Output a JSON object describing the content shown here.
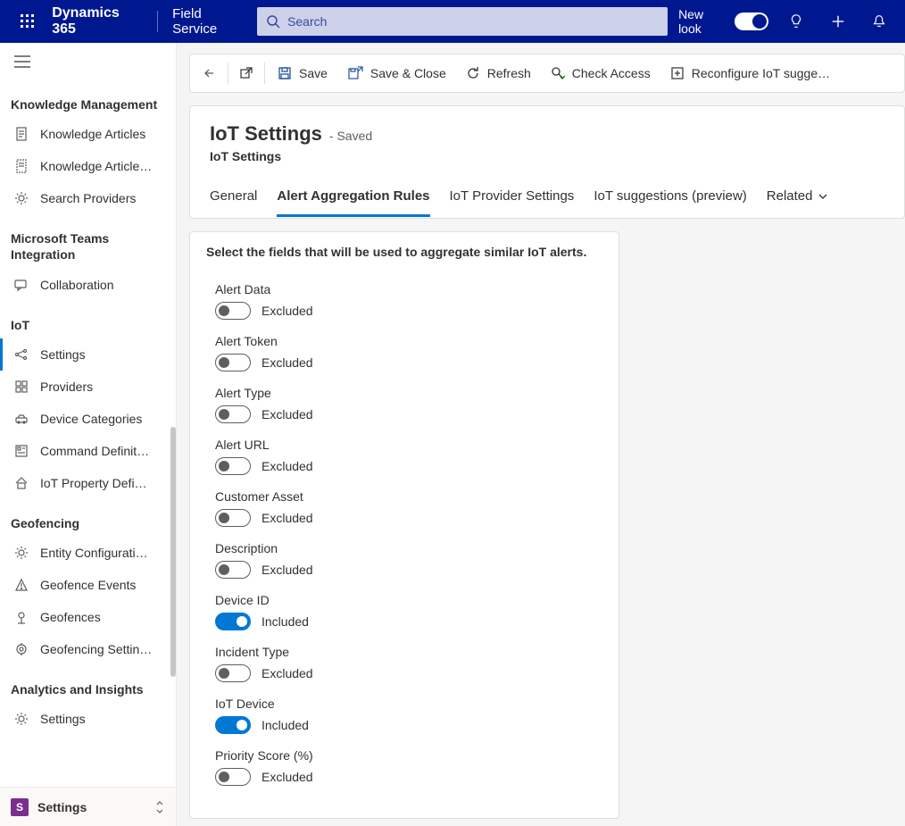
{
  "topbar": {
    "brand": "Dynamics 365",
    "appname": "Field Service",
    "search_placeholder": "Search",
    "newlook_label": "New look"
  },
  "sidebar": {
    "sections": [
      {
        "title": "Knowledge Management",
        "items": [
          {
            "icon": "doc",
            "label": "Knowledge Articles",
            "active": false
          },
          {
            "icon": "doc-dash",
            "label": "Knowledge Article…",
            "active": false
          },
          {
            "icon": "gear",
            "label": "Search Providers",
            "active": false
          }
        ]
      },
      {
        "title": "Microsoft Teams Integration",
        "items": [
          {
            "icon": "chat",
            "label": "Collaboration",
            "active": false
          }
        ]
      },
      {
        "title": "IoT",
        "items": [
          {
            "icon": "nodes",
            "label": "Settings",
            "active": true
          },
          {
            "icon": "grid",
            "label": "Providers",
            "active": false
          },
          {
            "icon": "car",
            "label": "Device Categories",
            "active": false
          },
          {
            "icon": "cmd",
            "label": "Command Definit…",
            "active": false
          },
          {
            "icon": "house",
            "label": "IoT Property Defi…",
            "active": false
          }
        ]
      },
      {
        "title": "Geofencing",
        "items": [
          {
            "icon": "gear",
            "label": "Entity Configurati…",
            "active": false
          },
          {
            "icon": "warn",
            "label": "Geofence Events",
            "active": false
          },
          {
            "icon": "pin",
            "label": "Geofences",
            "active": false
          },
          {
            "icon": "target",
            "label": "Geofencing Settin…",
            "active": false
          }
        ]
      },
      {
        "title": "Analytics and Insights",
        "items": [
          {
            "icon": "gear",
            "label": "Settings",
            "active": false
          }
        ]
      }
    ],
    "area": {
      "letter": "S",
      "label": "Settings"
    }
  },
  "commandbar": {
    "save": "Save",
    "saveclose": "Save & Close",
    "refresh": "Refresh",
    "checkaccess": "Check Access",
    "reconf": "Reconfigure IoT sugge…"
  },
  "page": {
    "title": "IoT Settings",
    "saved": "- Saved",
    "subtitle": "IoT Settings",
    "tabs": [
      {
        "label": "General",
        "active": false,
        "chevron": false
      },
      {
        "label": "Alert Aggregation Rules",
        "active": true,
        "chevron": false
      },
      {
        "label": "IoT Provider Settings",
        "active": false,
        "chevron": false
      },
      {
        "label": "IoT suggestions (preview)",
        "active": false,
        "chevron": false
      },
      {
        "label": "Related",
        "active": false,
        "chevron": true
      }
    ],
    "instruction": "Select the fields that will be used to aggregate similar IoT alerts.",
    "state_on": "Included",
    "state_off": "Excluded",
    "fields": [
      {
        "label": "Alert Data",
        "on": false
      },
      {
        "label": "Alert Token",
        "on": false
      },
      {
        "label": "Alert Type",
        "on": false
      },
      {
        "label": "Alert URL",
        "on": false
      },
      {
        "label": "Customer Asset",
        "on": false
      },
      {
        "label": "Description",
        "on": false
      },
      {
        "label": "Device ID",
        "on": true
      },
      {
        "label": "Incident Type",
        "on": false
      },
      {
        "label": "IoT Device",
        "on": true
      },
      {
        "label": "Priority Score (%)",
        "on": false
      }
    ]
  }
}
